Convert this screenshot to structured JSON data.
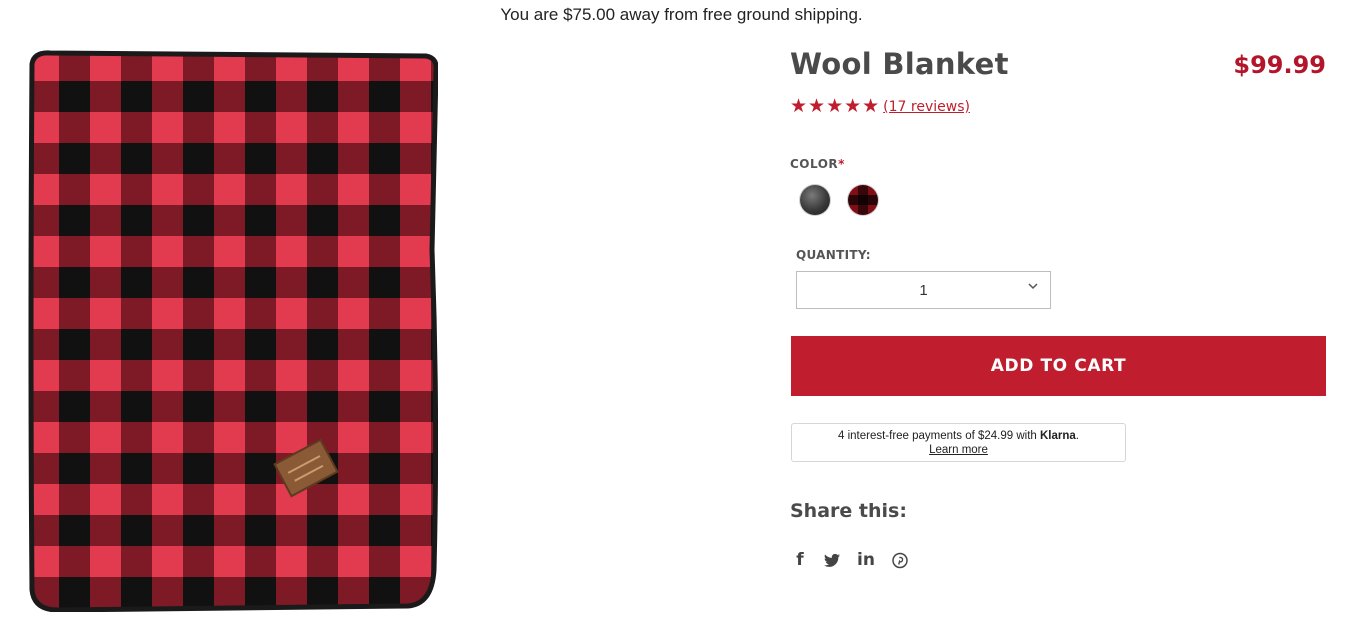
{
  "banner": {
    "shipping_message": "You are $75.00 away from free ground shipping."
  },
  "product": {
    "title": "Wool Blanket",
    "price": "$99.99",
    "rating": 5,
    "stars_text": "★★★★★",
    "reviews_link": "(17 reviews)",
    "image_icon": "buffalo-plaid-blanket",
    "colors": [
      "#b3162a",
      "#111111"
    ]
  },
  "options": {
    "color_label": "COLOR",
    "required_marker": "*",
    "swatches": [
      {
        "name": "gray-swatch",
        "color": "#3a3a3a"
      },
      {
        "name": "red-black-swatch",
        "color": "#7e0f17"
      }
    ],
    "quantity_label": "QUANTITY:",
    "quantity_value": "1"
  },
  "cart": {
    "add_to_cart_label": "ADD TO CART",
    "accent": "#c01e2e"
  },
  "klarna": {
    "text_before": "4 interest-free payments of $24.99 with ",
    "brand": "Klarna",
    "text_after": ".",
    "learn_more": "Learn more"
  },
  "share": {
    "title": "Share this:",
    "icons": {
      "facebook": "f",
      "twitter": "twitter-icon",
      "linkedin": "in",
      "pinterest": "pinterest-icon"
    }
  }
}
